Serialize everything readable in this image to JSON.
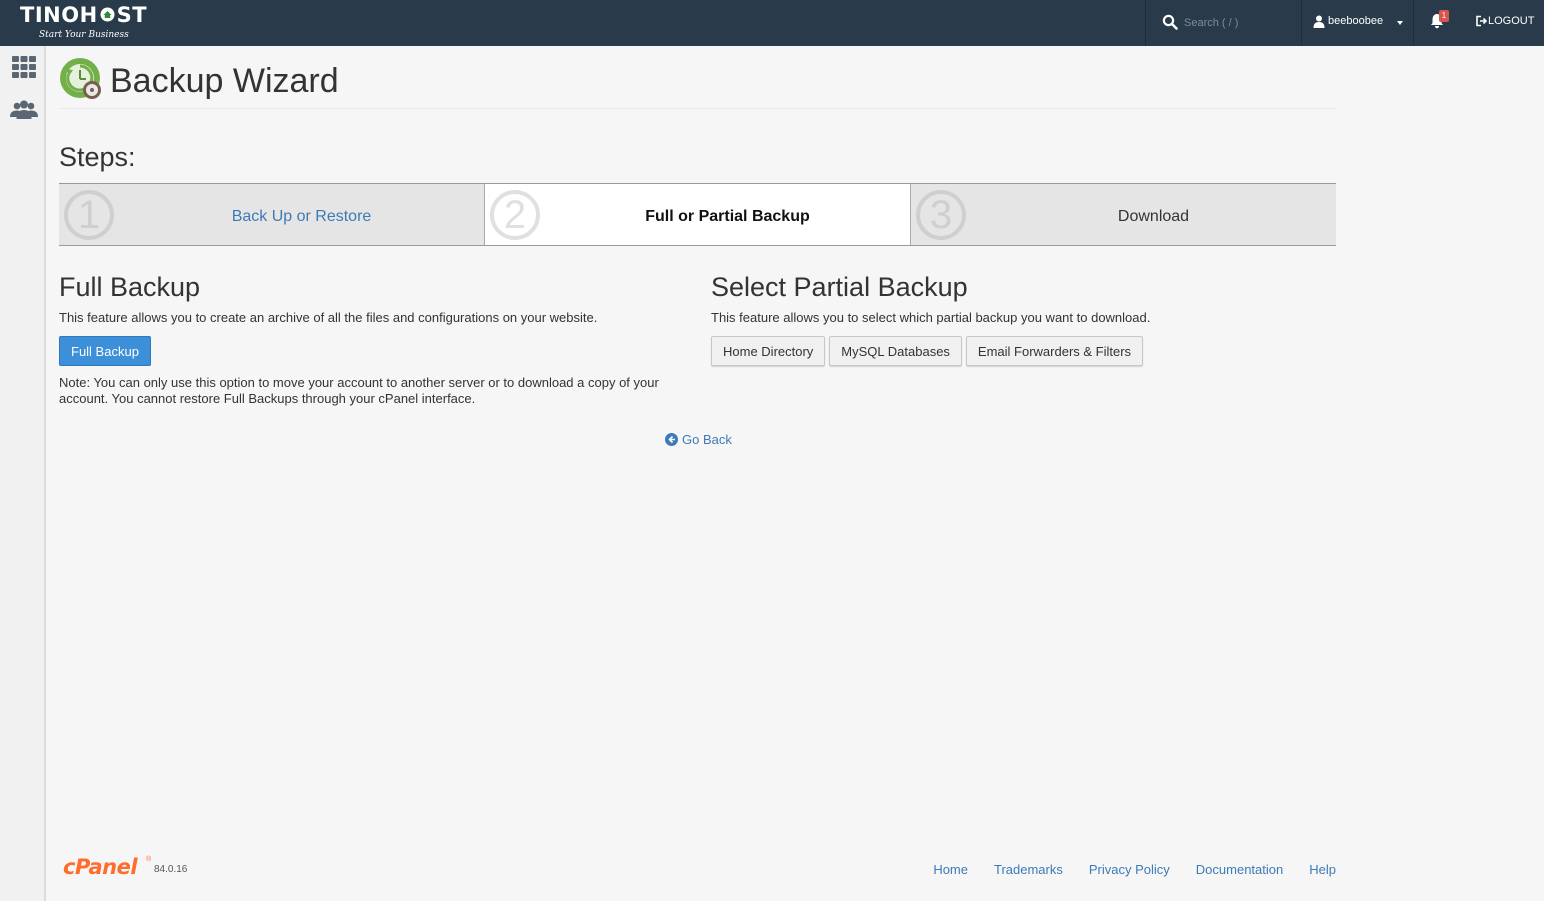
{
  "brand": {
    "logo_text": "TINOHOST",
    "logo_prefix": "TINOH",
    "logo_suffix": "ST",
    "tagline": "Start Your Business",
    "accent_green": "#2e8b3e"
  },
  "topbar": {
    "search_placeholder": "Search ( / )",
    "search_icon": "search-icon",
    "username": "beeboobee",
    "notification_count": "1",
    "logout_label": "LOGOUT"
  },
  "leftrail": {
    "items": [
      {
        "icon": "grid-apps-icon"
      },
      {
        "icon": "users-icon"
      }
    ]
  },
  "page": {
    "title": "Backup Wizard",
    "steps_label": "Steps:",
    "steps": [
      {
        "number": "1",
        "label": "Back Up or Restore",
        "state": "link"
      },
      {
        "number": "2",
        "label": "Full or Partial Backup",
        "state": "active"
      },
      {
        "number": "3",
        "label": "Download",
        "state": "inactive"
      }
    ],
    "full_backup": {
      "title": "Full Backup",
      "description": "This feature allows you to create an archive of all the files and configurations on your website.",
      "button_label": "Full Backup",
      "note": "Note: You can only use this option to move your account to another server or to download a copy of your account. You cannot restore Full Backups through your cPanel interface."
    },
    "partial_backup": {
      "title": "Select Partial Backup",
      "description": "This feature allows you to select which partial backup you want to download.",
      "buttons": [
        "Home Directory",
        "MySQL Databases",
        "Email Forwarders & Filters"
      ]
    },
    "go_back_label": "Go Back"
  },
  "footer": {
    "logo_text": "cPanel",
    "version": "84.0.16",
    "links": [
      "Home",
      "Trademarks",
      "Privacy Policy",
      "Documentation",
      "Help"
    ]
  },
  "colors": {
    "topbar_bg": "#293a4a",
    "link": "#3d7ab8",
    "primary_button": "#3d8fd8",
    "cpanel_orange": "#ff6c2c"
  }
}
